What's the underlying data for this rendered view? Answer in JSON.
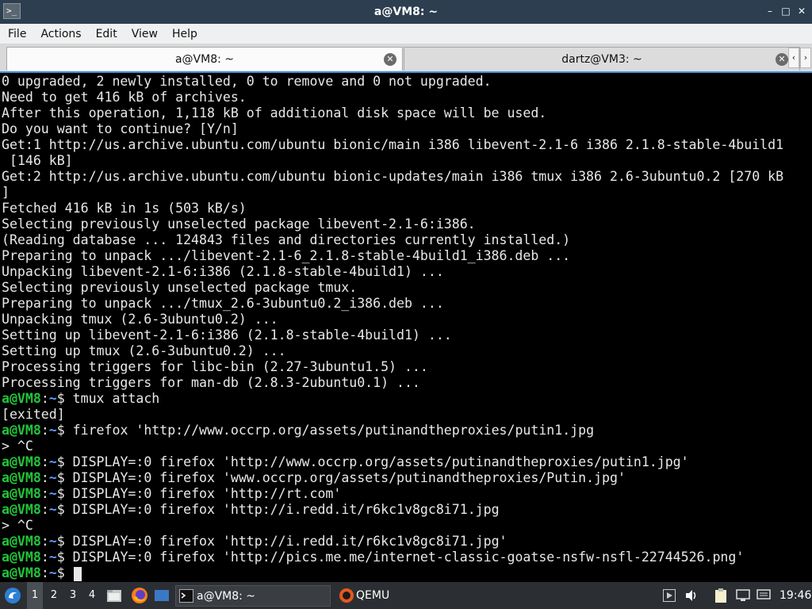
{
  "window": {
    "title": "a@VM8: ~",
    "controls": {
      "minimize": "–",
      "maximize": "□",
      "close": "✕"
    }
  },
  "menu": [
    "File",
    "Actions",
    "Edit",
    "View",
    "Help"
  ],
  "tabs": [
    {
      "label": "a@VM8: ~",
      "active": true
    },
    {
      "label": "dartz@VM3: ~",
      "active": false
    }
  ],
  "tab_scroll": {
    "left": "‹",
    "right": "›"
  },
  "terminal": {
    "output": [
      "0 upgraded, 2 newly installed, 0 to remove and 0 not upgraded.",
      "Need to get 416 kB of archives.",
      "After this operation, 1,118 kB of additional disk space will be used.",
      "Do you want to continue? [Y/n]",
      "Get:1 http://us.archive.ubuntu.com/ubuntu bionic/main i386 libevent-2.1-6 i386 2.1.8-stable-4build1",
      " [146 kB]",
      "Get:2 http://us.archive.ubuntu.com/ubuntu bionic-updates/main i386 tmux i386 2.6-3ubuntu0.2 [270 kB",
      "]",
      "Fetched 416 kB in 1s (503 kB/s)",
      "Selecting previously unselected package libevent-2.1-6:i386.",
      "(Reading database ... 124843 files and directories currently installed.)",
      "Preparing to unpack .../libevent-2.1-6_2.1.8-stable-4build1_i386.deb ...",
      "Unpacking libevent-2.1-6:i386 (2.1.8-stable-4build1) ...",
      "Selecting previously unselected package tmux.",
      "Preparing to unpack .../tmux_2.6-3ubuntu0.2_i386.deb ...",
      "Unpacking tmux (2.6-3ubuntu0.2) ...",
      "Setting up libevent-2.1-6:i386 (2.1.8-stable-4build1) ...",
      "Setting up tmux (2.6-3ubuntu0.2) ...",
      "Processing triggers for libc-bin (2.27-3ubuntu1.5) ...",
      "Processing triggers for man-db (2.8.3-2ubuntu0.1) ..."
    ],
    "prompt_user": "a@VM8",
    "prompt_sep": ":",
    "prompt_dir": "~",
    "prompt_symbol": "$",
    "session": [
      {
        "type": "cmd",
        "text": " tmux attach"
      },
      {
        "type": "out",
        "text": "[exited]"
      },
      {
        "type": "cmd",
        "text": " firefox 'http://www.occrp.org/assets/putinandtheproxies/putin1.jpg"
      },
      {
        "type": "out",
        "text": "> ^C"
      },
      {
        "type": "cmd",
        "text": " DISPLAY=:0 firefox 'http://www.occrp.org/assets/putinandtheproxies/putin1.jpg'"
      },
      {
        "type": "cmd",
        "text": " DISPLAY=:0 firefox 'www.occrp.org/assets/putinandtheproxies/Putin.jpg'"
      },
      {
        "type": "cmd",
        "text": " DISPLAY=:0 firefox 'http://rt.com'"
      },
      {
        "type": "cmd",
        "text": " DISPLAY=:0 firefox 'http://i.redd.it/r6kc1v8gc8i71.jpg"
      },
      {
        "type": "out",
        "text": "> ^C"
      },
      {
        "type": "cmd",
        "text": " DISPLAY=:0 firefox 'http://i.redd.it/r6kc1v8gc8i71.jpg'"
      },
      {
        "type": "cmd",
        "text": " DISPLAY=:0 firefox 'http://pics.me.me/internet-classic-goatse-nsfw-nsfl-22744526.png'"
      },
      {
        "type": "cmd",
        "text": " "
      }
    ]
  },
  "taskbar": {
    "desktops": [
      "1",
      "2",
      "3",
      "4"
    ],
    "tasks": [
      {
        "label": "a@VM8: ~",
        "icon": "terminal-icon",
        "active": true
      },
      {
        "label": "QEMU",
        "icon": "qemu-icon",
        "active": false
      }
    ],
    "clock": "19:46",
    "icons": [
      "start-menu-icon",
      "file-manager-icon",
      "firefox-icon",
      "show-desktop-icon",
      "media-icon",
      "volume-icon",
      "clipboard-icon",
      "network-icon",
      "keyboard-icon"
    ]
  }
}
